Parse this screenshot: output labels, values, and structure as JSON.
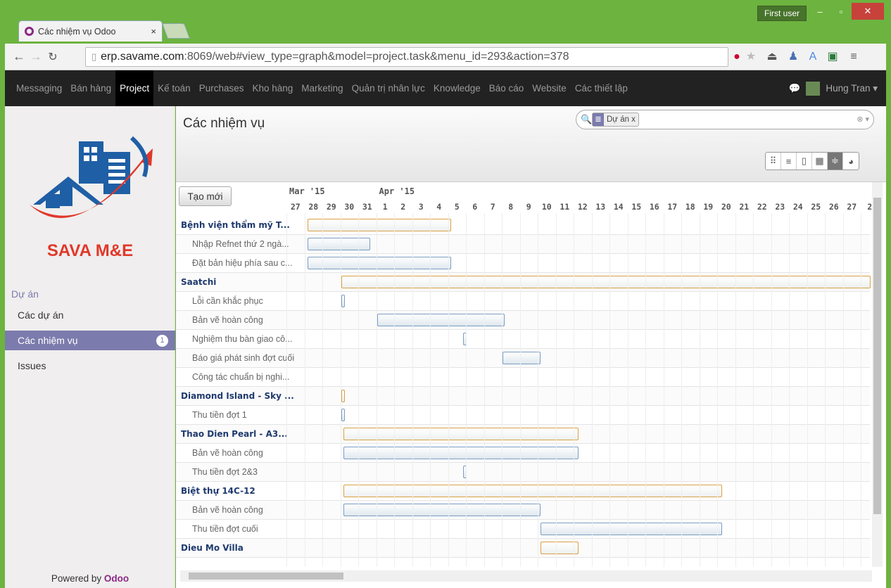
{
  "browser": {
    "tab_title": "Các nhiệm vụ  Odoo",
    "tab_close": "×",
    "user_badge": "First user",
    "url_domain": "erp.savame.com",
    "url_path": ":8069/web#view_type=graph&model=project.task&menu_id=293&action=378"
  },
  "nav": {
    "items": [
      "Messaging",
      "Bán hàng",
      "Project",
      "Kế toán",
      "Purchases",
      "Kho hàng",
      "Marketing",
      "Quản trị nhân lực",
      "Knowledge",
      "Báo cáo",
      "Website",
      "Các thiết lập"
    ],
    "active": "Project",
    "user_name": "Hung Tran ▾"
  },
  "sidebar": {
    "logo_text": "SAVA M&E",
    "section": "Dự án",
    "items": [
      {
        "label": "Các dự án"
      },
      {
        "label": "Các nhiệm vụ",
        "badge": "1"
      },
      {
        "label": "Issues"
      }
    ],
    "powered_prefix": "Powered by ",
    "powered_brand": "Odoo"
  },
  "page": {
    "title": "Các nhiệm vụ",
    "facet": "Dự án x",
    "create_label": "Tạo mới"
  },
  "gantt": {
    "months": [
      {
        "label": "Mar '15",
        "day_index": 0
      },
      {
        "label": "Apr '15",
        "day_index": 5
      }
    ],
    "days": [
      "27",
      "28",
      "29",
      "30",
      "31",
      "1",
      "2",
      "3",
      "4",
      "5",
      "6",
      "7",
      "8",
      "9",
      "10",
      "11",
      "12",
      "13",
      "14",
      "15",
      "16",
      "17",
      "18",
      "19",
      "20",
      "21",
      "22",
      "23",
      "24",
      "25",
      "26",
      "27",
      "2"
    ],
    "rows": [
      {
        "label": "Bệnh viện thẩm mỹ T...",
        "project": true,
        "start": 1,
        "end": 9
      },
      {
        "label": "Nhập Refnet thứ 2 ngà...",
        "start": 1,
        "end": 4.5
      },
      {
        "label": "Đặt bản hiệu phía sau c...",
        "start": 1,
        "end": 9
      },
      {
        "label": "Saatchi",
        "project": true,
        "start": 2.9,
        "end": 32.4
      },
      {
        "label": "Lỗi cần khắc phục",
        "start": 2.9,
        "end": 3.1
      },
      {
        "label": "Bản vẽ hoàn công",
        "start": 4.9,
        "end": 12
      },
      {
        "label": "Nghiệm thu bàn giao cô...",
        "start": 9.7,
        "end": 9.9
      },
      {
        "label": "Báo giá phát sinh đợt cuối",
        "start": 11.9,
        "end": 14
      },
      {
        "label": "Công tác chuẩn bị nghi..."
      },
      {
        "label": "Diamond Island - Sky ...",
        "project": true,
        "start": 2.9,
        "end": 3.1
      },
      {
        "label": "Thu tiền đợt 1",
        "start": 2.9,
        "end": 3.1
      },
      {
        "label": "Thao Dien Pearl - A3...",
        "project": true,
        "start": 3,
        "end": 16.1
      },
      {
        "label": "Bản vẽ hoàn công",
        "start": 3,
        "end": 16.1
      },
      {
        "label": "Thu tiền đợt 2&3",
        "start": 9.7,
        "end": 9.9
      },
      {
        "label": "Biệt thự 14C-12",
        "project": true,
        "start": 3,
        "end": 24.1
      },
      {
        "label": "Bản vẽ hoàn công",
        "start": 3,
        "end": 14
      },
      {
        "label": "Thu tiền đợt cuối",
        "start": 14,
        "end": 24.1
      },
      {
        "label": "Dieu Mo Villa",
        "project": true,
        "start": 14,
        "end": 16.1
      }
    ]
  }
}
